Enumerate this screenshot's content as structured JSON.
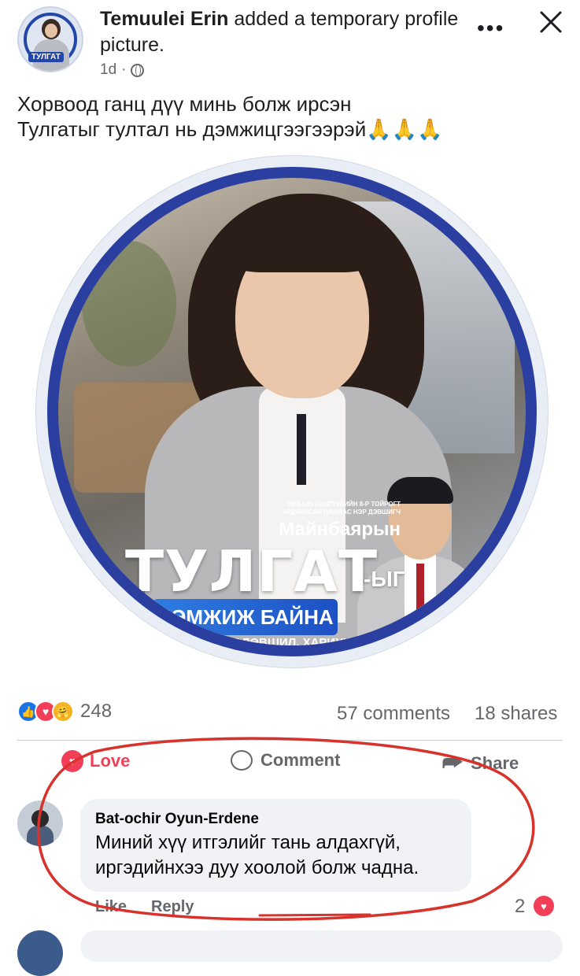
{
  "post": {
    "author": "Temuulei Erin",
    "action": "added a temporary profile picture.",
    "time": "1d",
    "separator": "·",
    "text_line1": "Хорвоод ганц дүү минь болж ирсэн",
    "text_line2": "Тулгатыг тултал нь дэмжицгээгээрэй🙏🙏🙏",
    "more_icon": "ellipsis-icon",
    "close_icon": "close-icon"
  },
  "avatar": {
    "badge": "ТУЛГАТ"
  },
  "campaign": {
    "small_line1": "УИХ-ЫН СОНГУУЛИЙН 8-Р ТОЙРОГТ",
    "small_line2": "АРДЧИЛСАН НАМААС НЭР ДЭВШИГЧ",
    "name": "Майнбаярын",
    "big": "ТУЛГАТ",
    "suffix": "-ЫГ",
    "support": "ДЭМЖИЖ БАЙНА",
    "slogan": "ТӨЛӨВШИЛ, ХАРИУЦЛАГА"
  },
  "stats": {
    "reaction_count": "248",
    "comments": "57 comments",
    "shares": "18 shares"
  },
  "actions": {
    "love": "Love",
    "comment": "Comment",
    "share": "Share"
  },
  "comment": {
    "author": "Bat-ochir Oyun-Erdene",
    "line1": "Миний хүү итгэлийг тань алдахгүй,",
    "line2": "иргэдийнхээ дуу хоолой болж чадна.",
    "like": "Like",
    "reply": "Reply",
    "reaction_count": "2"
  },
  "colors": {
    "accent_blue": "#1b74e4",
    "love_red": "#f33e58",
    "annotation_red": "#d8322d",
    "campaign_blue": "#2a3fa0"
  }
}
